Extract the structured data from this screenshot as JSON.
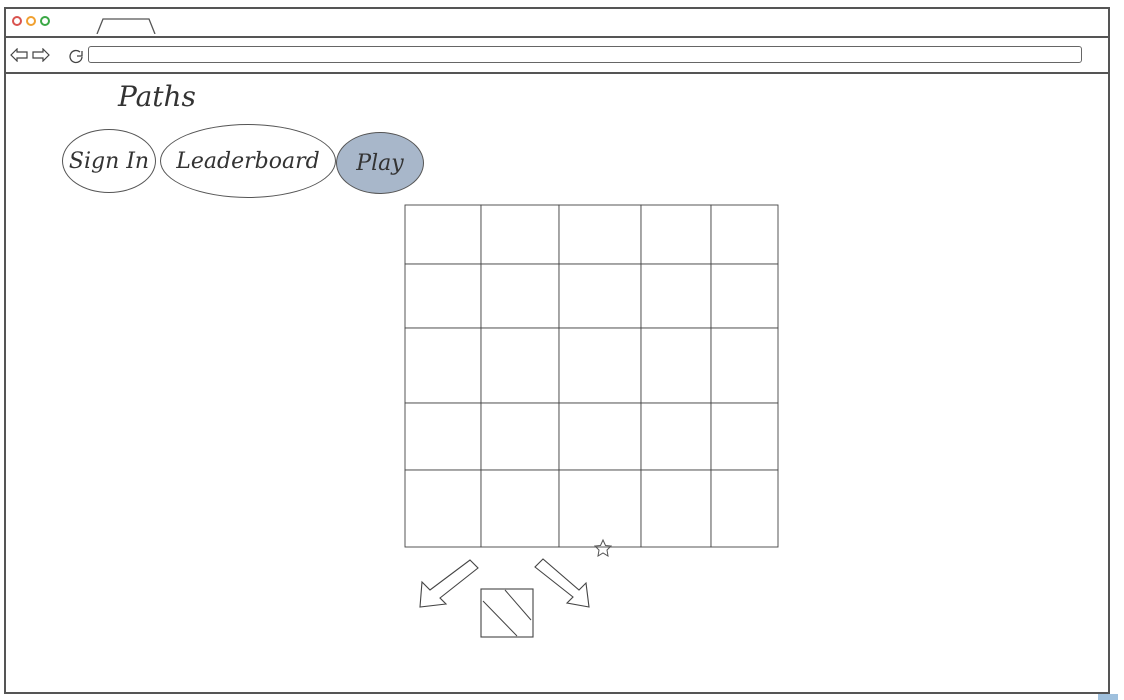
{
  "app": {
    "title": "Paths"
  },
  "nav": {
    "buttons": [
      {
        "label": "Sign In"
      },
      {
        "label": "Leaderboard"
      },
      {
        "label": "Play",
        "active": true
      }
    ]
  },
  "browser": {
    "back_icon": "back-arrow-icon",
    "forward_icon": "forward-arrow-icon",
    "reload_icon": "reload-icon",
    "url": ""
  },
  "board": {
    "rows": 5,
    "cols": 5,
    "goal_icon": "star-icon"
  },
  "controls": {
    "left_icon": "arrow-down-left-icon",
    "center_icon": "tile-icon",
    "right_icon": "arrow-down-right-icon"
  },
  "colors": {
    "active_button": "#a8b7ca",
    "close_dot": "#d9534f",
    "min_dot": "#f0a030",
    "max_dot": "#3aa845"
  }
}
